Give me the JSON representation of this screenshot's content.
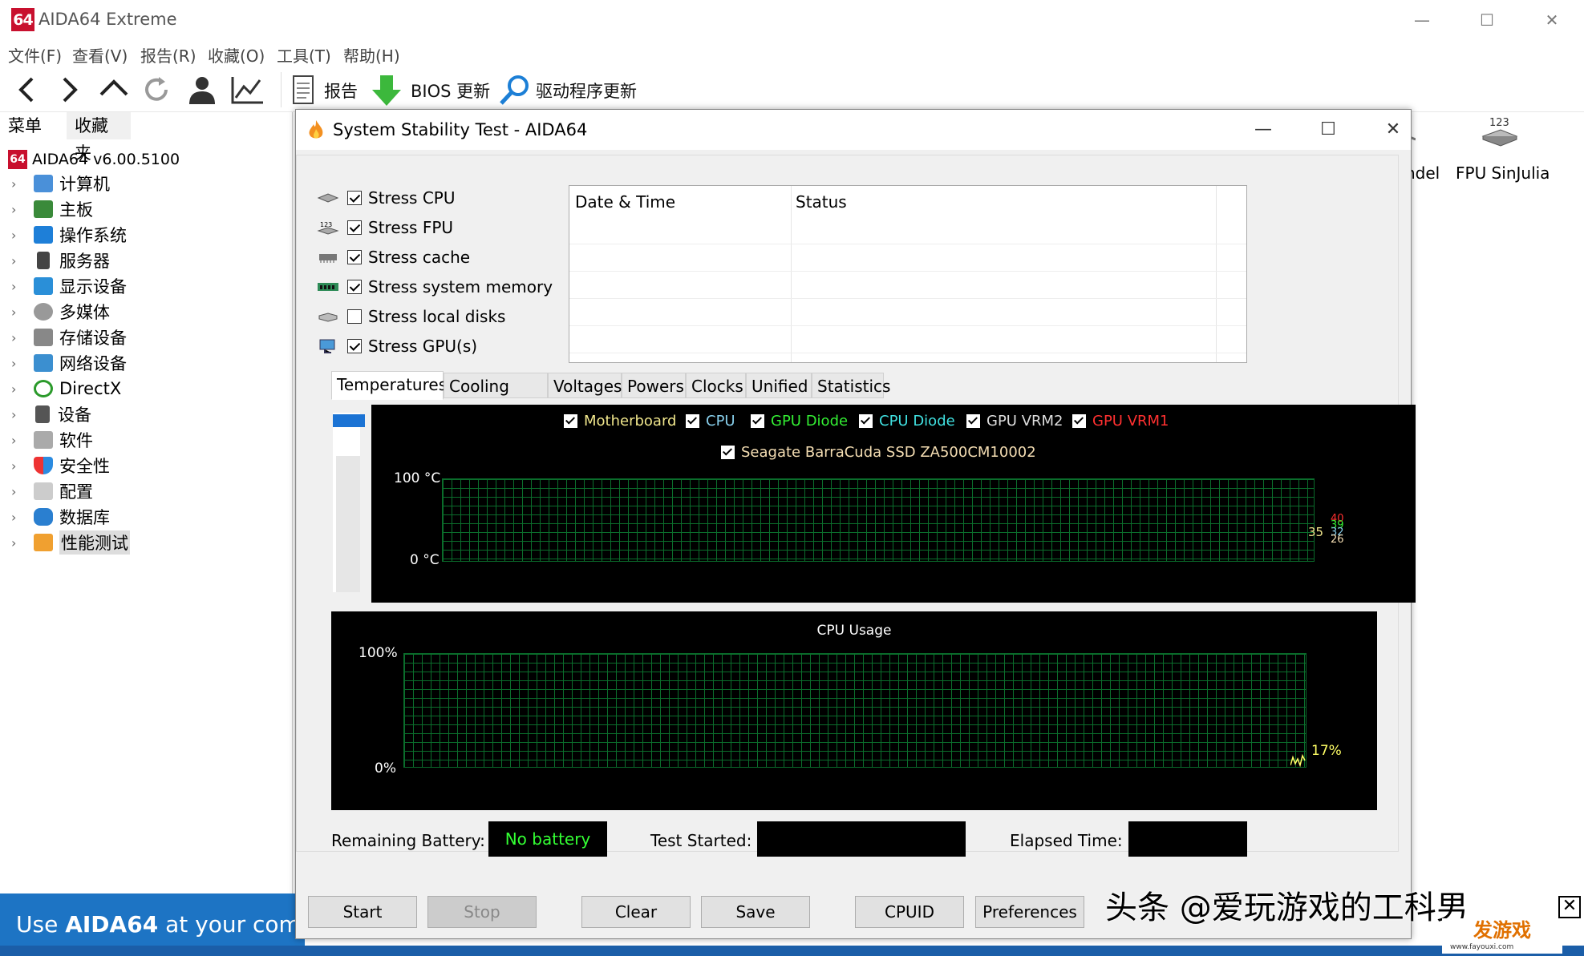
{
  "app": {
    "logo": "64",
    "title": "AIDA64 Extreme",
    "window_controls": {
      "minimize": "—",
      "maximize": "☐",
      "close": "✕"
    }
  },
  "menubar": [
    "文件(F)",
    "查看(V)",
    "报告(R)",
    "收藏(O)",
    "工具(T)",
    "帮助(H)"
  ],
  "toolbar": {
    "report_label": "报告",
    "bios_label": "BIOS 更新",
    "driver_label": "驱动程序更新"
  },
  "leftpanel": {
    "tab_menu": "菜单",
    "tab_favorites": "收藏夹",
    "root_logo": "64",
    "root_label": "AIDA64 v6.00.5100",
    "items": [
      {
        "label": "计算机",
        "icon": "computer-icon"
      },
      {
        "label": "主板",
        "icon": "motherboard-icon"
      },
      {
        "label": "操作系统",
        "icon": "windows-icon"
      },
      {
        "label": "服务器",
        "icon": "server-icon"
      },
      {
        "label": "显示设备",
        "icon": "display-icon"
      },
      {
        "label": "多媒体",
        "icon": "multimedia-icon"
      },
      {
        "label": "存储设备",
        "icon": "storage-icon"
      },
      {
        "label": "网络设备",
        "icon": "network-icon"
      },
      {
        "label": "DirectX",
        "icon": "xbox-icon"
      },
      {
        "label": "设备",
        "icon": "device-icon"
      },
      {
        "label": "软件",
        "icon": "software-icon"
      },
      {
        "label": "安全性",
        "icon": "security-shield-icon"
      },
      {
        "label": "配置",
        "icon": "config-icon"
      },
      {
        "label": "数据库",
        "icon": "database-icon"
      },
      {
        "label": "性能测试",
        "icon": "benchmark-icon"
      }
    ]
  },
  "background_icons": {
    "mandel_label": "ndel",
    "fpu_label": "FPU SinJulia",
    "fpu_glyph": "123"
  },
  "banner": {
    "prefix": "Use ",
    "brand": "AIDA64",
    "suffix": " at your comp"
  },
  "dialog": {
    "title": "System Stability Test - AIDA64",
    "stress_options": [
      {
        "label": "Stress CPU",
        "checked": true
      },
      {
        "label": "Stress FPU",
        "checked": true
      },
      {
        "label": "Stress cache",
        "checked": true
      },
      {
        "label": "Stress system memory",
        "checked": true
      },
      {
        "label": "Stress local disks",
        "checked": false
      },
      {
        "label": "Stress GPU(s)",
        "checked": true
      }
    ],
    "log_headers": {
      "date_time": "Date & Time",
      "status": "Status"
    },
    "tabs": [
      "Temperatures",
      "Cooling Fans",
      "Voltages",
      "Powers",
      "Clocks",
      "Unified",
      "Statistics"
    ],
    "temperature_graph": {
      "legend": [
        {
          "label": "Motherboard",
          "color": "#f0e68c"
        },
        {
          "label": "CPU",
          "color": "#87ceeb"
        },
        {
          "label": "GPU Diode",
          "color": "#33ee33"
        },
        {
          "label": "CPU Diode",
          "color": "#40e0e0"
        },
        {
          "label": "GPU VRM2",
          "color": "#dddddd"
        },
        {
          "label": "GPU VRM1",
          "color": "#ff3030"
        },
        {
          "label": "Seagate BarraCuda SSD ZA500CM10002",
          "color": "#f5deb3"
        }
      ],
      "y_max": "100 °C",
      "y_min": "0 °C",
      "value_main": "35",
      "values_stack": [
        "40",
        "39",
        "32",
        "26"
      ]
    },
    "cpu_graph": {
      "title": "CPU Usage",
      "y_max": "100%",
      "y_min": "0%",
      "current": "17%"
    },
    "status_row": {
      "battery_label": "Remaining Battery:",
      "battery_value": "No battery",
      "started_label": "Test Started:",
      "elapsed_label": "Elapsed Time:"
    },
    "buttons": {
      "start": "Start",
      "stop": "Stop",
      "clear": "Clear",
      "save": "Save",
      "cpuid": "CPUID",
      "preferences": "Preferences"
    }
  },
  "watermark": {
    "text": "头条 @爱玩游戏的工科男",
    "close": "✕",
    "logo": "发游戏",
    "url": "www.fayouxi.com"
  }
}
